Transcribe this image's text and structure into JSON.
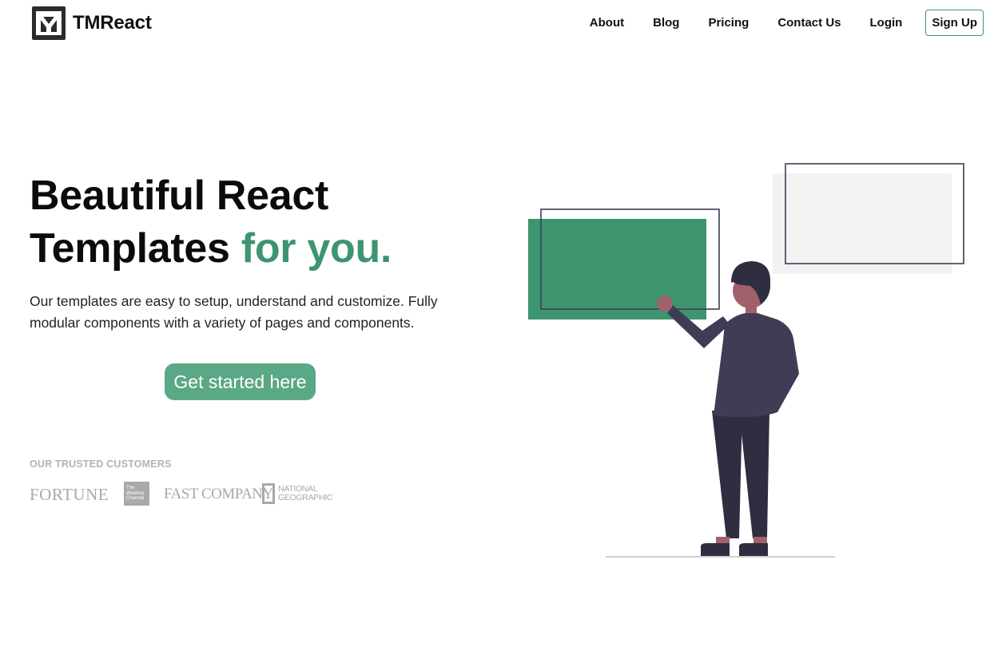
{
  "brand": {
    "name": "TMReact",
    "logo_icon": "tm-monogram-icon"
  },
  "nav": {
    "items": [
      {
        "label": "About"
      },
      {
        "label": "Blog"
      },
      {
        "label": "Pricing"
      },
      {
        "label": "Contact Us"
      },
      {
        "label": "Login"
      }
    ],
    "signup_label": "Sign Up"
  },
  "hero": {
    "title_line1": "Beautiful React",
    "title_line2": "Templates ",
    "title_accent": "for you.",
    "subtitle": "Our templates are easy to setup, understand and customize. Fully modular components with a variety of pages and components.",
    "cta_label": "Get started here"
  },
  "trusted": {
    "heading": "OUR TRUSTED CUSTOMERS",
    "logos": {
      "fortune": "FORTUNE",
      "weather_line1": "The",
      "weather_line2": "Weather",
      "weather_line3": "Channel",
      "fastcompany": "FAST COMPANY",
      "natgeo_line1": "NATIONAL",
      "natgeo_line2": "GEOGRAPHIC"
    }
  },
  "colors": {
    "accent": "#3d9570",
    "cta": "#5aa885",
    "figure_top": "#3f3d56",
    "figure_pants": "#2f2e41",
    "skin": "#a0616a",
    "panel_gray": "#f2f2f2",
    "logo_gray": "#a9a9a9"
  }
}
